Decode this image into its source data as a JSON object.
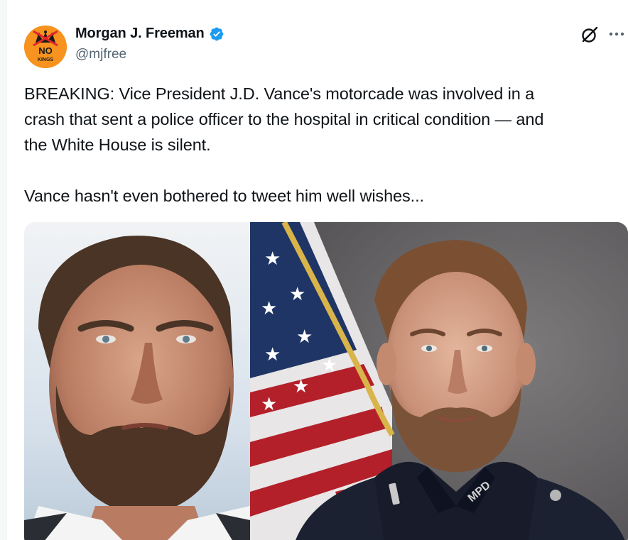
{
  "author": {
    "display_name": "Morgan J. Freeman",
    "handle": "@mjfree",
    "verified": true,
    "avatar_text": [
      "NO",
      "KINGS"
    ]
  },
  "header_icons": {
    "grok": "grok-icon",
    "more": "more-options-icon"
  },
  "tweet": {
    "lines": [
      "BREAKING: Vice President J.D. Vance's motorcade was involved in a",
      "crash that sent a police officer to the hospital in critical condition — and",
      "the White House is silent."
    ],
    "lines2": [
      "Vance hasn't even bothered to tweet him well wishes..."
    ]
  },
  "media": {
    "left_photo": "portrait-photo-man-beard",
    "right_photo": "police-officer-portrait-flag",
    "badge_text": "MPD"
  },
  "colors": {
    "verified_blue": "#1d9bf0",
    "text": "#0f1419",
    "secondary_text": "#536471",
    "avatar_bg": "#f7931e",
    "avatar_red": "#e0262b"
  }
}
